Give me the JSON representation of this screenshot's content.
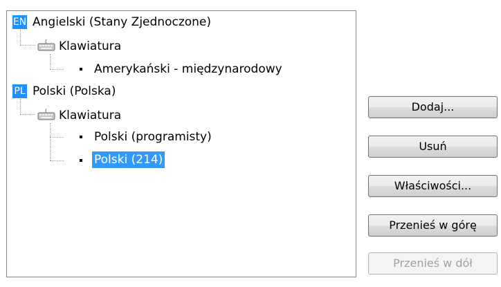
{
  "tree": {
    "lang1": {
      "badge": "EN",
      "label": "Angielski (Stany Zjednoczone)",
      "group_label": "Klawiatura",
      "items": [
        "Amerykański - międzynarodowy"
      ]
    },
    "lang2": {
      "badge": "PL",
      "label": "Polski (Polska)",
      "group_label": "Klawiatura",
      "items": [
        "Polski (programisty)",
        "Polski (214)"
      ]
    }
  },
  "buttons": {
    "add": "Dodaj...",
    "remove": "Usuń",
    "properties": "Właściwości...",
    "move_up": "Przenieś w górę",
    "move_down": "Przenieś w dół"
  },
  "colors": {
    "badge": "#1e90ff",
    "selection": "#3399ff"
  }
}
